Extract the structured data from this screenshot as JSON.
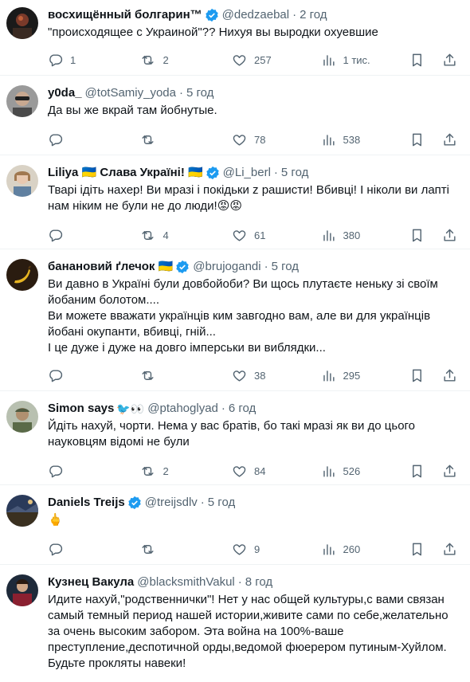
{
  "tweets": [
    {
      "name": "восхищённый болгарин™",
      "flag": false,
      "emoji": "",
      "verified": true,
      "handle": "@dedzaebal",
      "time": "2 год",
      "text": "\"происходящее с Украиной\"?? Нихуя вы выродки охуевшие",
      "replies": "1",
      "reposts": "2",
      "likes": "257",
      "views": "1 тис.",
      "avatar": "dark-portrait"
    },
    {
      "name": "y0da_",
      "flag": false,
      "emoji": "",
      "verified": false,
      "handle": "@totSamiy_yoda",
      "time": "5 год",
      "text": "Да вы же вкрай там йобнутые.",
      "replies": "",
      "reposts": "",
      "likes": "78",
      "views": "538",
      "avatar": "sunglasses-man"
    },
    {
      "name": "Liliya 🇺🇦 Слава Україні! 🇺🇦",
      "flag": false,
      "emoji": "",
      "verified": true,
      "handle": "@Li_berl",
      "time": "5 год",
      "text": "Тварі ідіть нахер! Ви мразі і покідьки z рашисти! Вбивці! І ніколи ви лапті нам ніким не були не до люди!😡😡",
      "replies": "",
      "reposts": "4",
      "likes": "61",
      "views": "380",
      "avatar": "woman-light"
    },
    {
      "name": "банановий ґлечок 🇺🇦",
      "flag": false,
      "emoji": "",
      "verified": true,
      "handle": "@brujogandi",
      "time": "5 год",
      "text": "Ви давно в Україні були довбойоби? Ви щось плутаєте неньку зі своїм йобаним болотом....\nВи можете вважати українців ким завгодно вам, але ви для українців йобані окупанти, вбивці, гній...\nІ це дуже і дуже на довго імперськи ви виблядки...",
      "replies": "",
      "reposts": "",
      "likes": "38",
      "views": "295",
      "avatar": "banana"
    },
    {
      "name": "Simon says",
      "flag": false,
      "emoji": "🐦👀",
      "verified": false,
      "handle": "@ptahoglyad",
      "time": "6 год",
      "text": "Йдіть нахуй, чорти. Нема у вас братів, бо такі мразі як ви до цього науковцям відомі не були",
      "replies": "",
      "reposts": "2",
      "likes": "84",
      "views": "526",
      "avatar": "soldier"
    },
    {
      "name": "Daniels Treijs",
      "flag": false,
      "emoji": "",
      "verified": true,
      "handle": "@treijsdlv",
      "time": "5 год",
      "text": "🖕",
      "replies": "",
      "reposts": "",
      "likes": "9",
      "views": "260",
      "avatar": "landscape"
    },
    {
      "name": "Кузнец Вакула",
      "flag": false,
      "emoji": "",
      "verified": false,
      "handle": "@blacksmithVakul",
      "time": "8 год",
      "text": "Идите нахуй,\"родственнички\"! Нет у нас общей культуры,с вами связан самый темный период нашей истории,живите сами по себе,желательно за очень высоким забором. Эта война на 100%-ваше преступление,деспотичной орды,ведомой фюерером путиным-Хуйлом. Будьте прокляты навеки!",
      "replies": "",
      "reposts": "",
      "likes": "",
      "views": "",
      "avatar": "painting"
    }
  ]
}
